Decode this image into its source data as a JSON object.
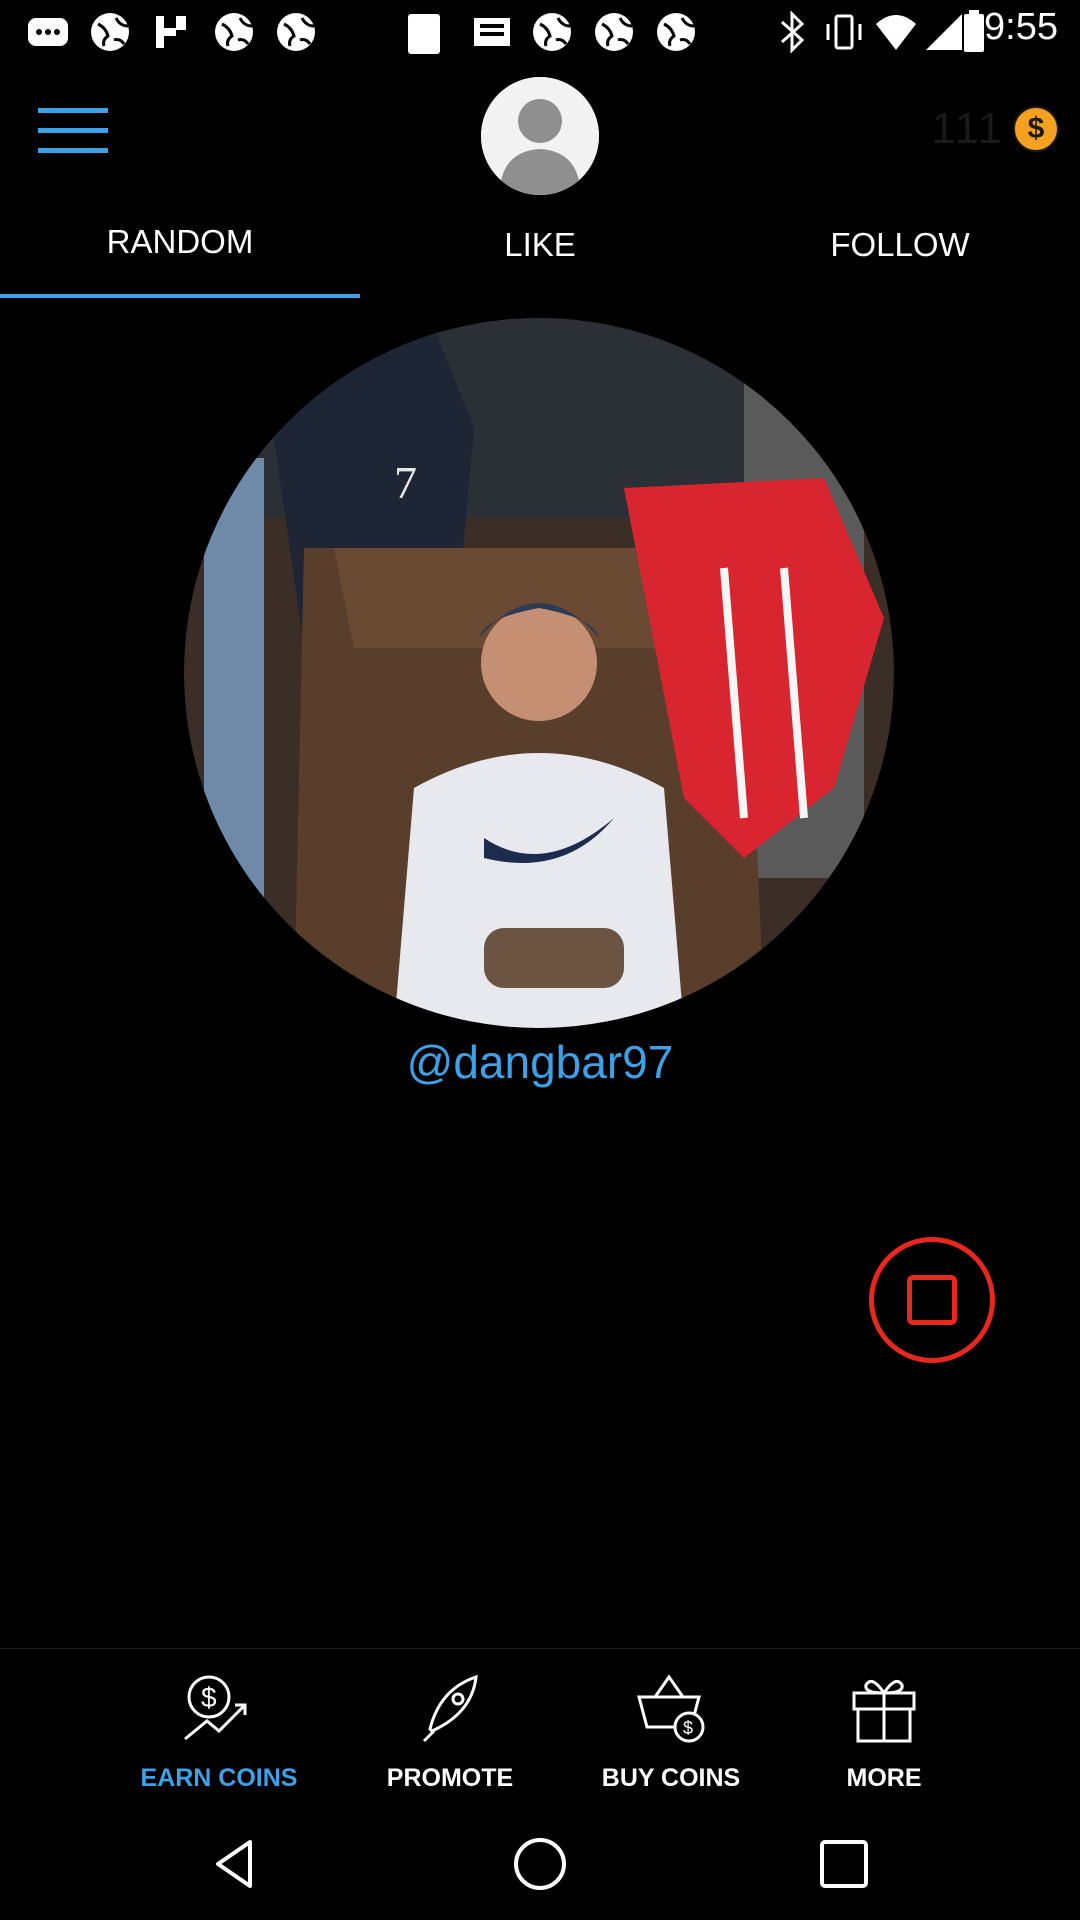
{
  "status_bar": {
    "time": "9:55",
    "icons": [
      "messages-icon",
      "globe-icon",
      "globe-icon",
      "fan-icon",
      "globe-icon",
      "globe-icon",
      "sim-card-icon",
      "inbox-icon",
      "globe-icon",
      "globe-icon",
      "globe-icon",
      "bluetooth-icon",
      "vibrate-icon",
      "wifi-icon",
      "cell-signal-icon",
      "battery-icon"
    ]
  },
  "header": {
    "menu_icon": "hamburger-menu-icon",
    "avatar_icon": "user-avatar-icon",
    "coin_count": "111",
    "coin_symbol": "$"
  },
  "tabs": [
    {
      "label": "RANDOM",
      "active": true
    },
    {
      "label": "LIKE",
      "active": false
    },
    {
      "label": "FOLLOW",
      "active": false
    }
  ],
  "profile": {
    "username": "@dangbar97"
  },
  "stop_button_icon": "stop-icon",
  "bottom_nav": [
    {
      "label": "EARN COINS",
      "icon": "earn-coins-icon",
      "active": true
    },
    {
      "label": "PROMOTE",
      "icon": "rocket-icon",
      "active": false
    },
    {
      "label": "BUY COINS",
      "icon": "basket-coin-icon",
      "active": false
    },
    {
      "label": "MORE",
      "icon": "gift-icon",
      "active": false
    }
  ],
  "system_nav": [
    "back-icon",
    "home-icon",
    "recents-icon"
  ],
  "colors": {
    "accent": "#3ca1e6",
    "coin": "#f3a11f",
    "stop": "#e8281e",
    "background": "#000000"
  }
}
